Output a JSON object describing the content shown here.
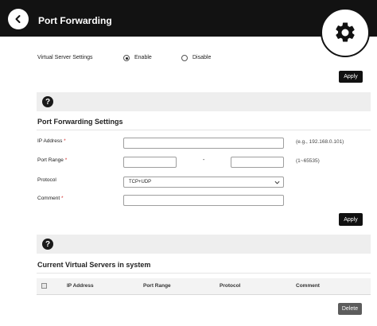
{
  "header": {
    "title": "Port Forwarding",
    "back_icon": "chevron-left-icon",
    "settings_icon": "gear-icon"
  },
  "virtual_server": {
    "label": "Virtual Server Settings",
    "options": [
      "Enable",
      "Disable"
    ],
    "selected": "Enable",
    "apply_label": "Apply"
  },
  "help_icon": "help-icon",
  "forwarding": {
    "title": "Port Forwarding Settings",
    "ip_label": "IP Address",
    "ip_value": "",
    "ip_hint": "(e.g., 192.168.0.101)",
    "port_label": "Port Range",
    "port_from": "",
    "port_to": "",
    "range_separator": "-",
    "port_hint": "(1~65535)",
    "protocol_label": "Protocol",
    "protocol_value": "TCP+UDP",
    "comment_label": "Comment",
    "comment_value": "",
    "required_mark": "*",
    "apply_label": "Apply"
  },
  "current": {
    "title": "Current Virtual Servers in system",
    "columns": [
      "IP Address",
      "Port Range",
      "Protocol",
      "Comment"
    ],
    "delete_label": "Delete"
  }
}
